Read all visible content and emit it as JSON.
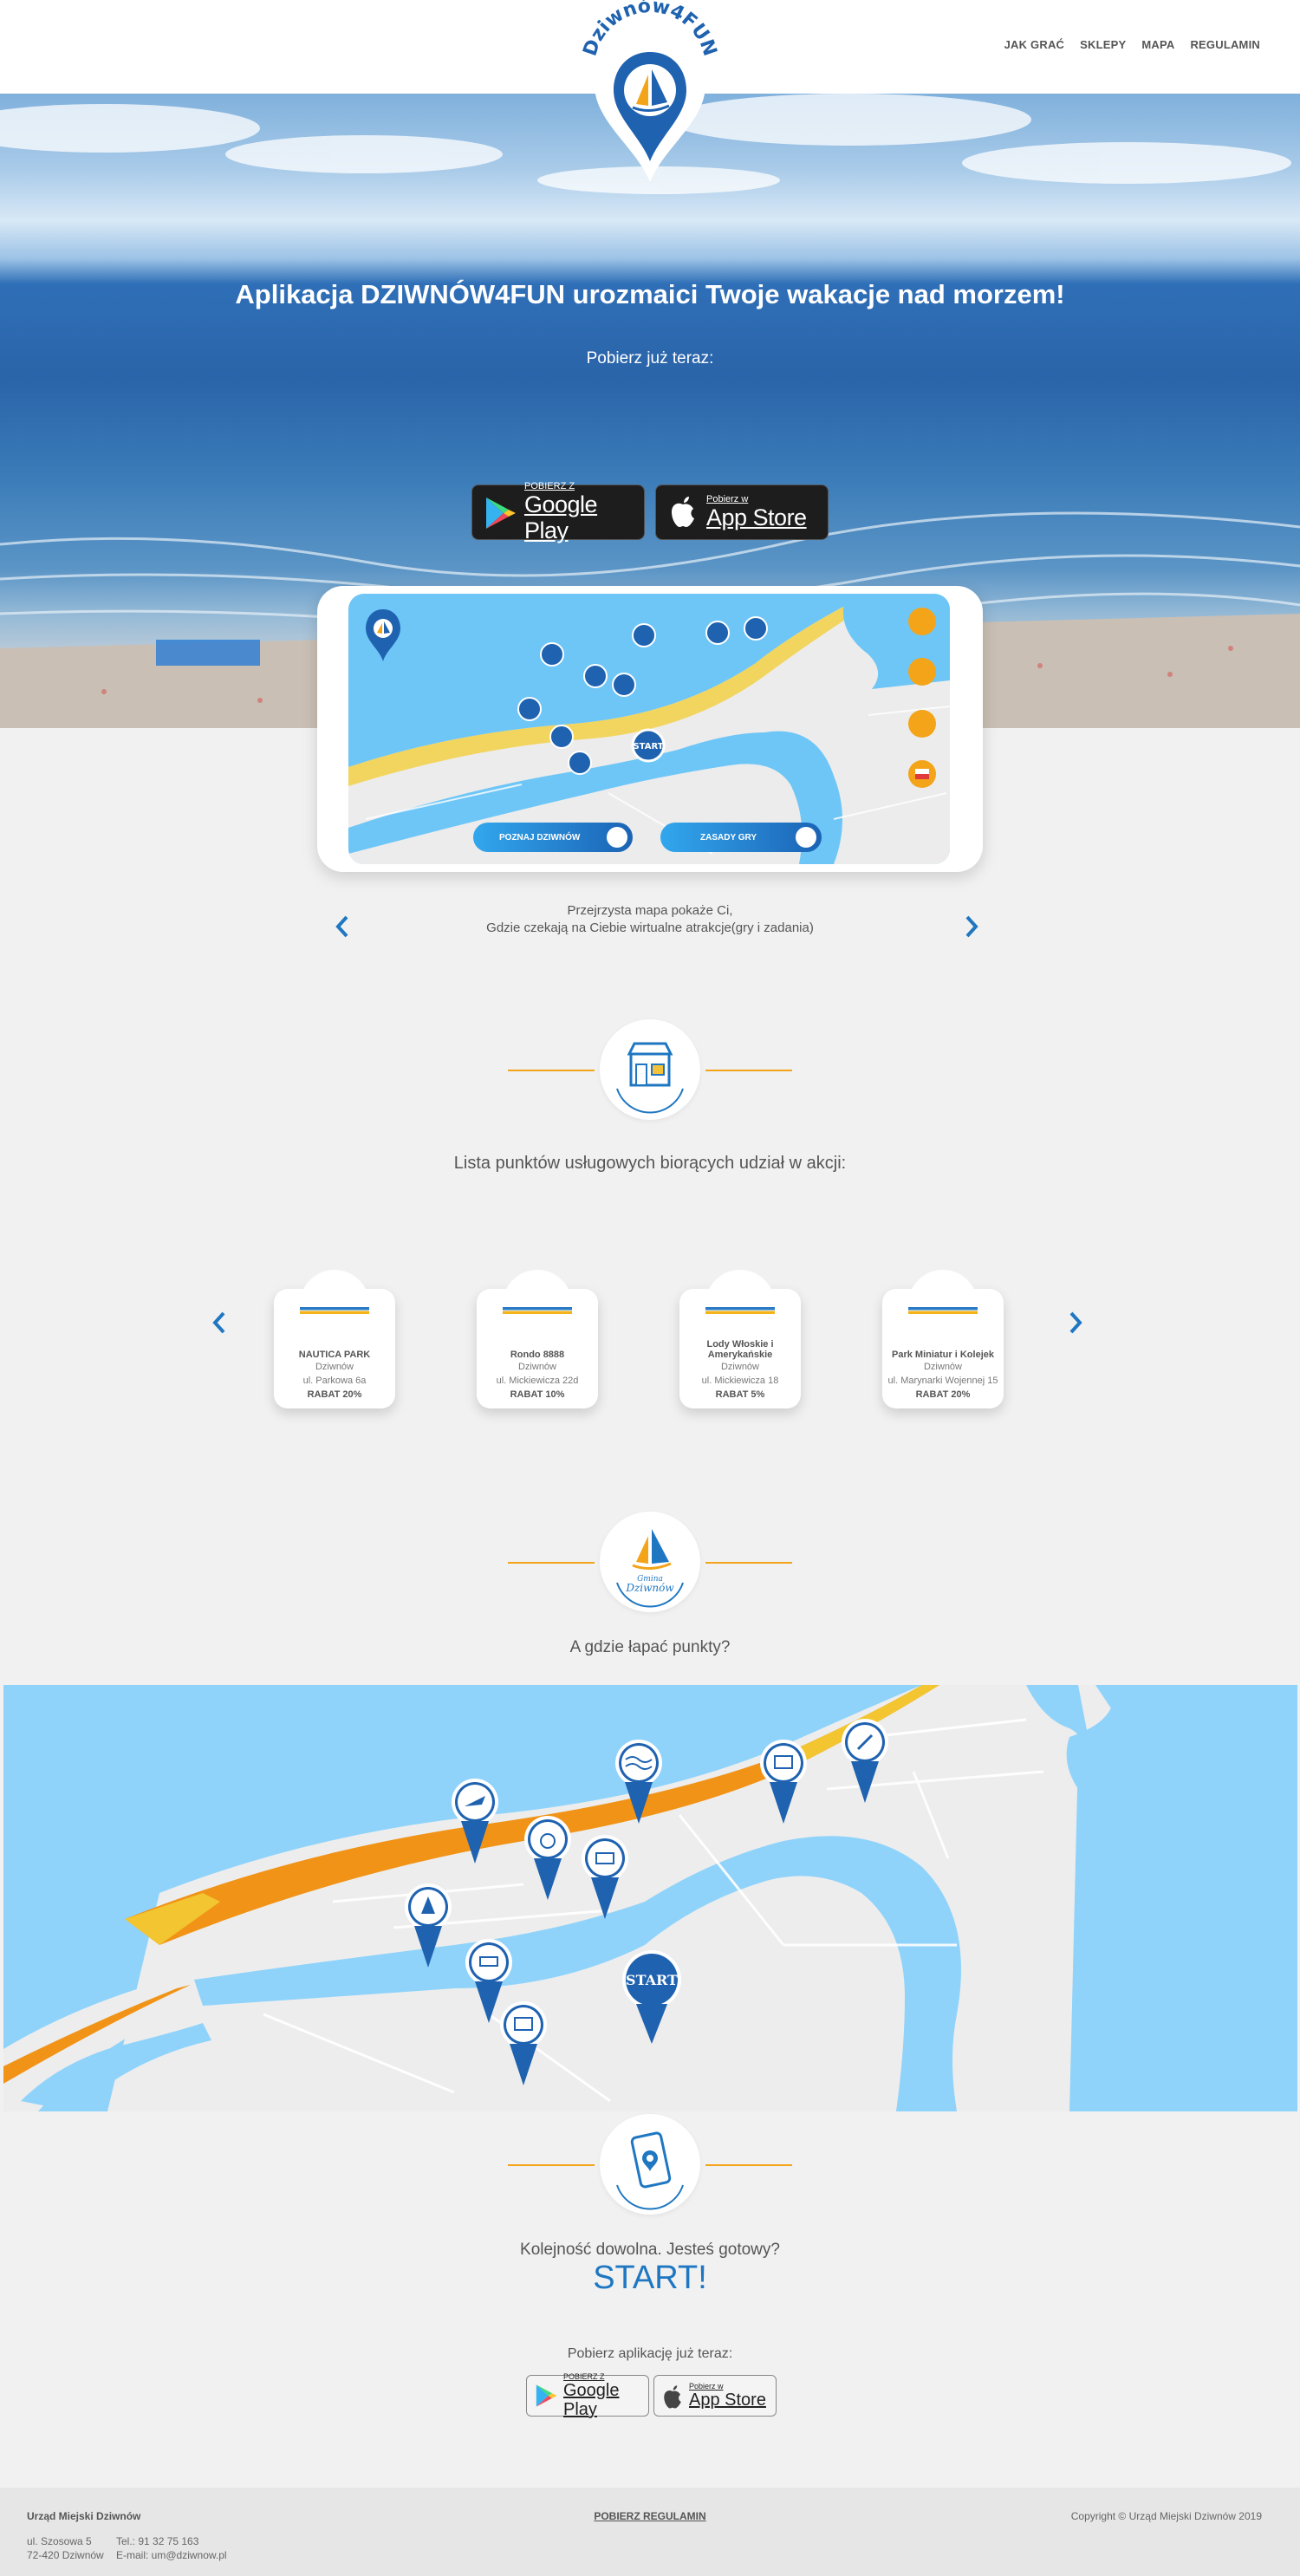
{
  "nav": {
    "items": [
      "JAK GRAĆ",
      "SKLEPY",
      "MAPA",
      "REGULAMIN"
    ]
  },
  "logo": {
    "text": "Dziwnów4FUN"
  },
  "hero": {
    "title": "Aplikacja DZIWNÓW4FUN urozmaici Twoje wakacje nad morzem!",
    "subtitle": "Pobierz już teraz:",
    "google_play": {
      "small": "POBIERZ Z",
      "big": "Google Play"
    },
    "app_store": {
      "small": "Pobierz w",
      "big": "App Store"
    }
  },
  "phone": {
    "logo_text": "Dziwnów4FUN",
    "start_label": "START",
    "explore_button": "POZNAJ DZIWNÓW",
    "rules_button": "ZASADY GRY"
  },
  "slider_caption": {
    "line1": "Przejrzysta mapa pokaże Ci,",
    "line2": "Gdzie czekają na Ciebie wirtualne atrakcje(gry i zadania)"
  },
  "shops": {
    "title": "Lista punktów usługowych biorących udział w akcji:",
    "items": [
      {
        "name": "NAUTICA PARK",
        "city": "Dziwnów",
        "address": "ul. Parkowa 6a",
        "discount": "RABAT 20%"
      },
      {
        "name": "Rondo 8888",
        "city": "Dziwnów",
        "address": "ul. Mickiewicza 22d",
        "discount": "RABAT 10%"
      },
      {
        "name": "Lody Włoskie i Amerykańskie",
        "city": "Dziwnów",
        "address": "ul. Mickiewicza 18",
        "discount": "RABAT 5%"
      },
      {
        "name": "Park Miniatur i Kolejek",
        "city": "Dziwnów",
        "address": "ul. Marynarki Wojennej 15",
        "discount": "RABAT 20%"
      }
    ]
  },
  "points": {
    "badge_line1": "Gmina",
    "badge_line2": "Dziwnów",
    "title": "A gdzie łapać punkty?",
    "start_label": "START"
  },
  "ready": {
    "question": "Kolejność dowolna. Jesteś gotowy?",
    "start": "START!",
    "download": "Pobierz aplikację już teraz:",
    "google_play": {
      "small": "POBIERZ Z",
      "big": "Google Play"
    },
    "app_store": {
      "small": "Pobierz w",
      "big": "App Store"
    }
  },
  "footer": {
    "title": "Urząd Miejski Dziwnów",
    "street": "ul. Szosowa 5",
    "postal": "72-420 Dziwnów",
    "phone": "Tel.: 91 32 75 163",
    "email": "E-mail: um@dziwnow.pl",
    "regulations": "POBIERZ REGULAMIN",
    "copyright": "Copyright © Urząd Miejski Dziwnów 2019"
  },
  "colors": {
    "accent_blue": "#1f77c2",
    "accent_orange": "#f3a419",
    "sea_light": "#8fd3fb"
  }
}
